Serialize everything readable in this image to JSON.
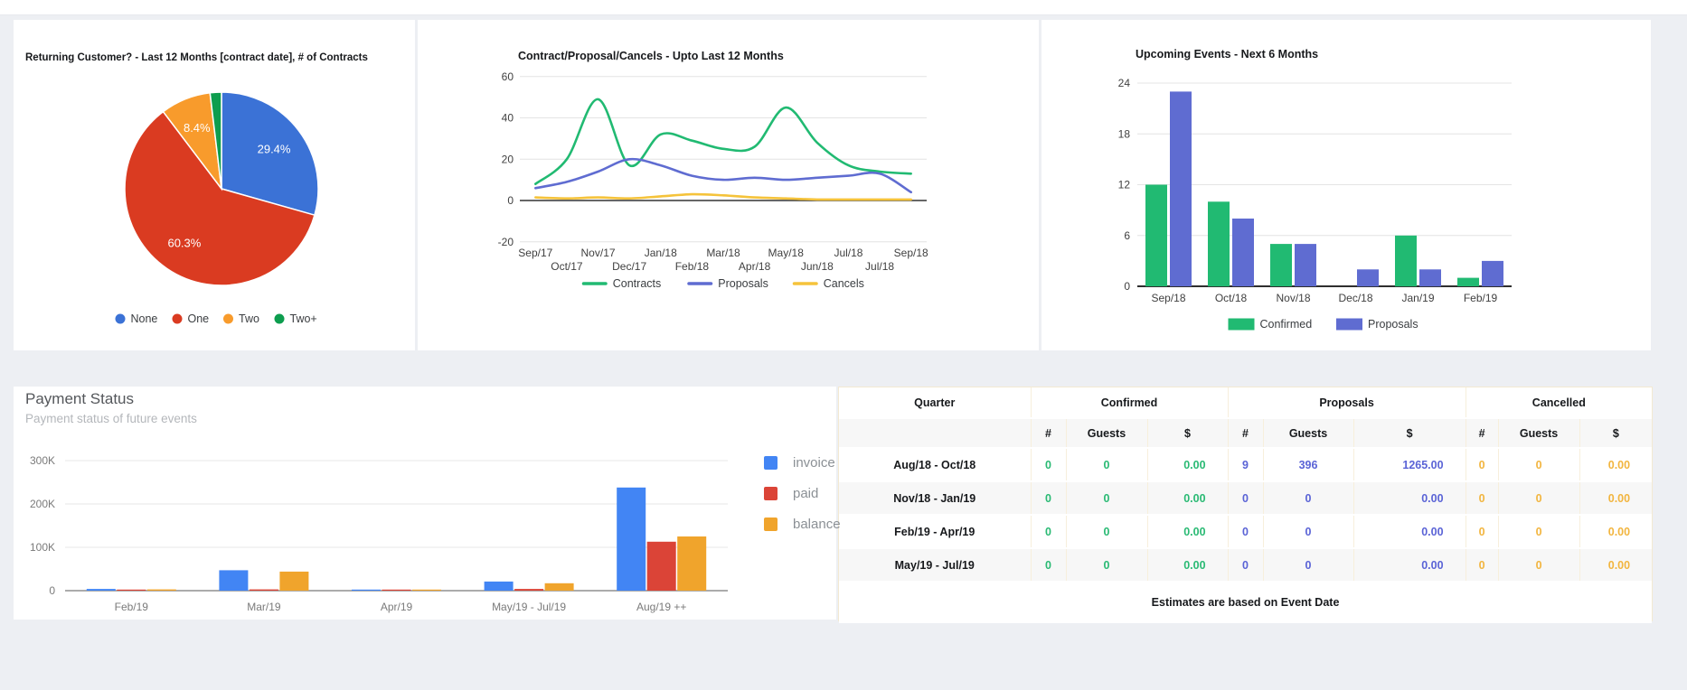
{
  "colors": {
    "page_bg": "#edeff3",
    "card_bg": "#ffffff",
    "pie_blue": "#3b72d6",
    "pie_red": "#da3b21",
    "pie_orange": "#f89b2c",
    "pie_green": "#0d9d4e",
    "emerald": "#21ba72",
    "indigo": "#5f6cd1",
    "cancel_yellow": "#f5c33b",
    "invoice_blue": "#4285f4",
    "paid_red": "#db4437",
    "balance_orange": "#f0a42c",
    "table_confirmed_text": "#2aba74",
    "table_proposals_text": "#5a63d6",
    "table_cancelled_text": "#f2b53f",
    "gridline": "#e4e4e4",
    "axis_text": "#404040",
    "muted_text": "#7a7a7a"
  },
  "chart_data": [
    {
      "id": "returning-customer-pie",
      "type": "pie",
      "title": "Returning Customer? - Last 12 Months [contract date], # of Contracts",
      "legend_position": "bottom",
      "slices": [
        {
          "label": "None",
          "value": 29.4,
          "display": "29.4%",
          "color": "#3b72d6"
        },
        {
          "label": "One",
          "value": 60.3,
          "display": "60.3%",
          "color": "#da3b21"
        },
        {
          "label": "Two",
          "value": 8.4,
          "display": "8.4%",
          "color": "#f89b2c"
        },
        {
          "label": "Two+",
          "value": 1.9,
          "display": "",
          "color": "#0d9d4e"
        }
      ]
    },
    {
      "id": "contract-proposal-cancels-line",
      "type": "line",
      "title": "Contract/Proposal/Cancels - Upto Last 12 Months",
      "x": [
        "Sep/17",
        "Oct/17",
        "Nov/17",
        "Dec/17",
        "Jan/18",
        "Feb/18",
        "Mar/18",
        "Apr/18",
        "May/18",
        "Jun/18",
        "Jul/18",
        "Jul/18",
        "Sep/18"
      ],
      "ylim": [
        -20,
        60
      ],
      "yticks": [
        60,
        40,
        20,
        0,
        -20
      ],
      "grid": true,
      "legend_position": "bottom",
      "series": [
        {
          "name": "Contracts",
          "color": "#21ba72",
          "values": [
            8,
            20,
            49,
            17,
            32,
            29,
            25,
            26,
            45,
            28,
            17,
            14,
            13
          ]
        },
        {
          "name": "Proposals",
          "color": "#5f6cd1",
          "values": [
            6,
            9,
            14,
            20,
            17,
            12,
            10,
            11,
            10,
            11,
            12,
            13,
            4
          ]
        },
        {
          "name": "Cancels",
          "color": "#f5c33b",
          "values": [
            1.5,
            1,
            1.5,
            1,
            2,
            3,
            2.5,
            1.5,
            1,
            0.5,
            0.5,
            0.5,
            0.5
          ]
        }
      ]
    },
    {
      "id": "upcoming-events-bar",
      "type": "bar",
      "title": "Upcoming Events - Next 6 Months",
      "categories": [
        "Sep/18",
        "Oct/18",
        "Nov/18",
        "Dec/18",
        "Jan/19",
        "Feb/19"
      ],
      "ylim": [
        0,
        24
      ],
      "yticks": [
        0,
        6,
        12,
        18,
        24
      ],
      "grid": true,
      "legend_position": "bottom",
      "series": [
        {
          "name": "Confirmed",
          "color": "#21ba72",
          "values": [
            12,
            10,
            5,
            0,
            6,
            1
          ]
        },
        {
          "name": "Proposals",
          "color": "#5f6cd1",
          "values": [
            23,
            8,
            5,
            2,
            2,
            3
          ]
        }
      ]
    },
    {
      "id": "payment-status-bar",
      "type": "bar",
      "title": "Payment Status",
      "subtitle": "Payment status of future events",
      "categories": [
        "Feb/19",
        "Mar/19",
        "Apr/19",
        "May/19 - Jul/19",
        "Aug/19 ++"
      ],
      "ylim": [
        0,
        300000
      ],
      "yticks": [
        {
          "value": 300000,
          "label": "300K"
        },
        {
          "value": 200000,
          "label": "200K"
        },
        {
          "value": 100000,
          "label": "100K"
        },
        {
          "value": 0,
          "label": "0"
        }
      ],
      "grid": true,
      "legend_position": "right",
      "series": [
        {
          "name": "invoice",
          "color": "#4285f4",
          "values": [
            4000,
            47000,
            1500,
            21000,
            238000
          ]
        },
        {
          "name": "paid",
          "color": "#db4437",
          "values": [
            1000,
            3000,
            500,
            4000,
            113000
          ]
        },
        {
          "name": "balance",
          "color": "#f0a42c",
          "values": [
            3000,
            44000,
            1000,
            17000,
            125000
          ]
        }
      ]
    }
  ],
  "table": {
    "group_headers": [
      {
        "label": "Quarter",
        "span": 1
      },
      {
        "label": "Confirmed",
        "span": 3
      },
      {
        "label": "Proposals",
        "span": 3
      },
      {
        "label": "Cancelled",
        "span": 3
      }
    ],
    "sub_headers": [
      "",
      "#",
      "Guests",
      "$",
      "#",
      "Guests",
      "$",
      "#",
      "Guests",
      "$"
    ],
    "rows": [
      {
        "quarter": "Aug/18 - Oct/18",
        "confirmed": [
          "0",
          "0",
          "0.00"
        ],
        "proposals": [
          "9",
          "396",
          "1265.00"
        ],
        "cancelled": [
          "0",
          "0",
          "0.00"
        ]
      },
      {
        "quarter": "Nov/18 - Jan/19",
        "confirmed": [
          "0",
          "0",
          "0.00"
        ],
        "proposals": [
          "0",
          "0",
          "0.00"
        ],
        "cancelled": [
          "0",
          "0",
          "0.00"
        ]
      },
      {
        "quarter": "Feb/19 - Apr/19",
        "confirmed": [
          "0",
          "0",
          "0.00"
        ],
        "proposals": [
          "0",
          "0",
          "0.00"
        ],
        "cancelled": [
          "0",
          "0",
          "0.00"
        ]
      },
      {
        "quarter": "May/19 - Jul/19",
        "confirmed": [
          "0",
          "0",
          "0.00"
        ],
        "proposals": [
          "0",
          "0",
          "0.00"
        ],
        "cancelled": [
          "0",
          "0",
          "0.00"
        ]
      }
    ],
    "footer": "Estimates are based on Event Date"
  }
}
